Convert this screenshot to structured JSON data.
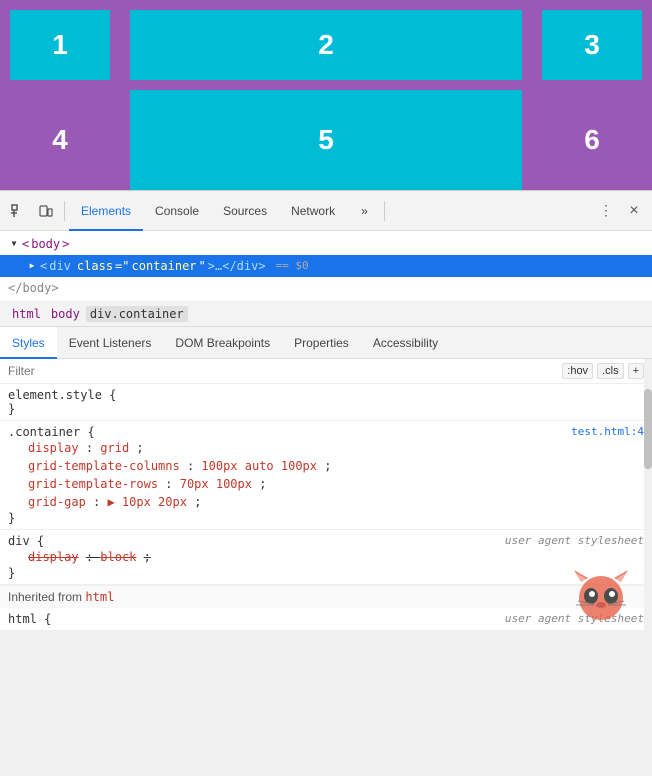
{
  "preview": {
    "cells": [
      {
        "id": 1,
        "color": "cyan",
        "label": "1"
      },
      {
        "id": 2,
        "color": "cyan",
        "label": "2"
      },
      {
        "id": 3,
        "color": "cyan",
        "label": "3"
      },
      {
        "id": 4,
        "color": "magenta",
        "label": "4"
      },
      {
        "id": 5,
        "color": "cyan",
        "label": "5"
      },
      {
        "id": 6,
        "color": "magenta",
        "label": "6"
      }
    ]
  },
  "toolbar": {
    "tabs": [
      "Elements",
      "Console",
      "Sources",
      "Network"
    ],
    "active_tab": "Elements",
    "more_label": "»",
    "close_label": "×"
  },
  "dom": {
    "rows": [
      {
        "indent": 0,
        "has_triangle": true,
        "triangle_open": true,
        "content": "<body>",
        "selected": false
      },
      {
        "indent": 1,
        "has_triangle": true,
        "triangle_open": true,
        "content": "<div class=\"container\">…</div>",
        "selected": true,
        "equals": "== $0"
      },
      {
        "indent": 0,
        "has_triangle": false,
        "content": "</body>",
        "selected": false
      }
    ]
  },
  "breadcrumb": {
    "items": [
      "html",
      "body",
      "div.container"
    ]
  },
  "panel_tabs": {
    "tabs": [
      "Styles",
      "Event Listeners",
      "DOM Breakpoints",
      "Properties",
      "Accessibility"
    ],
    "active": "Styles"
  },
  "filter": {
    "placeholder": "Filter",
    "hov_label": ":hov",
    "cls_label": ".cls",
    "plus_label": "+"
  },
  "css_rules": [
    {
      "selector": "element.style {",
      "close": "}",
      "source": "",
      "properties": []
    },
    {
      "selector": ".container {",
      "close": "}",
      "source": "test.html:4",
      "properties": [
        {
          "name": "display",
          "value": "grid",
          "strikethrough": false
        },
        {
          "name": "grid-template-columns",
          "value": "100px auto 100px",
          "strikethrough": false
        },
        {
          "name": "grid-template-rows",
          "value": "70px 100px",
          "strikethrough": false
        },
        {
          "name": "grid-gap",
          "value": "▶ 10px 20px",
          "strikethrough": false
        }
      ]
    },
    {
      "selector": "div {",
      "close": "}",
      "source": "user agent stylesheet",
      "properties": [
        {
          "name": "display",
          "value": "block",
          "strikethrough": true
        }
      ]
    }
  ],
  "inherited": {
    "label": "Inherited from",
    "from": "html"
  },
  "html_rule": {
    "selector": "html {",
    "source": "user agent stylesheet"
  }
}
